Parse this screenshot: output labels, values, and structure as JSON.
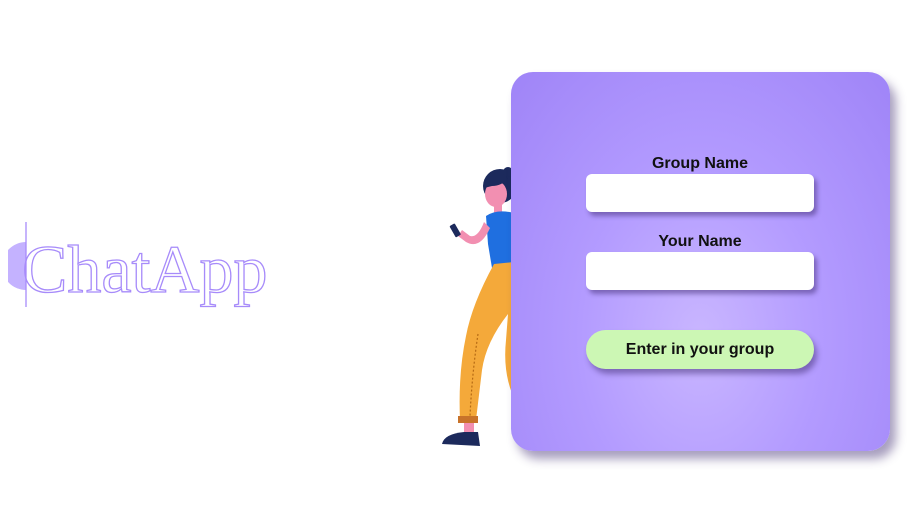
{
  "app": {
    "logo_text": "ChatApp"
  },
  "form": {
    "group_name_label": "Group Name",
    "group_name_value": "",
    "your_name_label": "Your Name",
    "your_name_value": "",
    "submit_label": "Enter in your group"
  },
  "illustration": {
    "icon": "woman-with-phone-illustration"
  },
  "colors": {
    "card_gradient_center": "#c9b6ff",
    "card_gradient_edge": "#9f84f7",
    "button_bg": "#ccf7b4",
    "logo_stroke": "#a78bfa",
    "logo_accent": "#c4b2ff"
  }
}
